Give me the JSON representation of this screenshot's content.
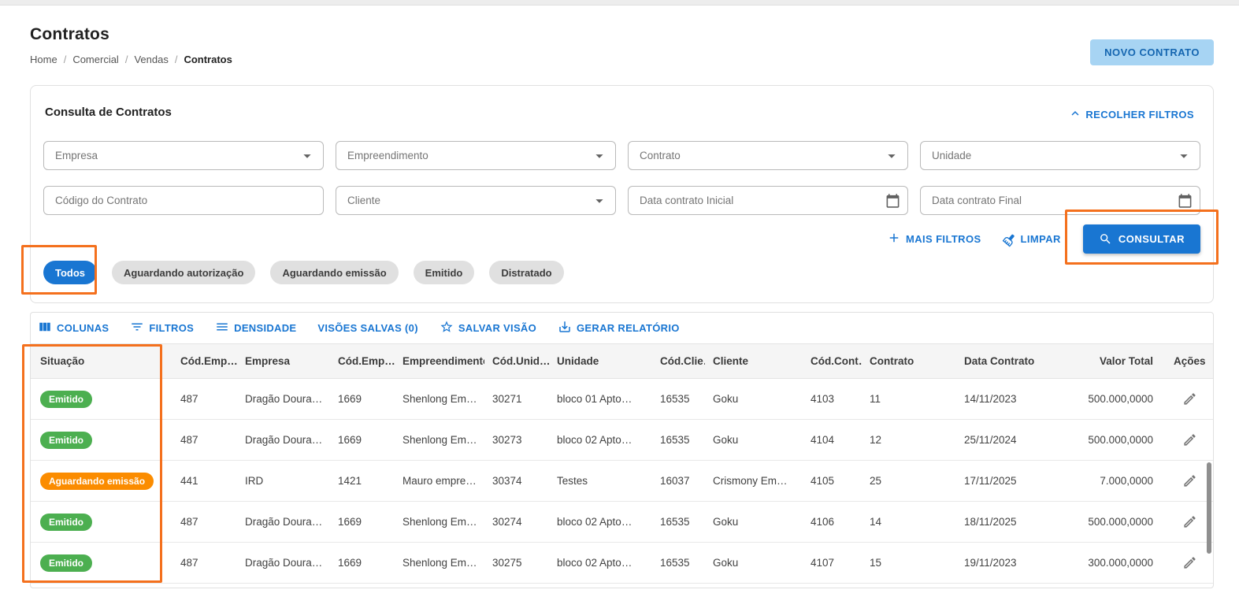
{
  "page": {
    "title": "Contratos",
    "breadcrumb": [
      "Home",
      "Comercial",
      "Vendas",
      "Contratos"
    ],
    "new_contract_label": "NOVO CONTRATO"
  },
  "filter_card": {
    "title": "Consulta de Contratos",
    "collapse_label": "RECOLHER FILTROS",
    "fields_row1": [
      {
        "placeholder": "Empresa",
        "type": "select"
      },
      {
        "placeholder": "Empreendimento",
        "type": "select"
      },
      {
        "placeholder": "Contrato",
        "type": "select"
      },
      {
        "placeholder": "Unidade",
        "type": "select"
      }
    ],
    "fields_row2": [
      {
        "placeholder": "Código do Contrato",
        "type": "text"
      },
      {
        "placeholder": "Cliente",
        "type": "select"
      },
      {
        "placeholder": "Data contrato Inicial",
        "type": "date"
      },
      {
        "placeholder": "Data contrato Final",
        "type": "date"
      }
    ],
    "more_filters_label": "MAIS FILTROS",
    "clear_label": "LIMPAR",
    "search_label": "CONSULTAR",
    "chips": [
      {
        "label": "Todos",
        "active": true
      },
      {
        "label": "Aguardando autorização",
        "active": false
      },
      {
        "label": "Aguardando emissão",
        "active": false
      },
      {
        "label": "Emitido",
        "active": false
      },
      {
        "label": "Distratado",
        "active": false
      }
    ]
  },
  "table_toolbar": {
    "items": [
      "COLUNAS",
      "FILTROS",
      "DENSIDADE",
      "VISÕES SALVAS (0)",
      "SALVAR VISÃO",
      "GERAR RELATÓRIO"
    ]
  },
  "table": {
    "headers": [
      "Situação",
      "Cód.Emp…",
      "Empresa",
      "Cód.Emp…",
      "Empreendimento",
      "Cód.Unid…",
      "Unidade",
      "Cód.Clie…",
      "Cliente",
      "Cód.Cont…",
      "Contrato",
      "Data Contrato",
      "Valor Total",
      "Ações"
    ],
    "rows": [
      {
        "situacao": "Emitido",
        "status_color": "green",
        "cod_emp": "487",
        "empresa": "Dragão Doura…",
        "cod_empreend": "1669",
        "empreendimento": "Shenlong Em…",
        "cod_unid": "30271",
        "unidade": "bloco 01 Apto…",
        "cod_cliente": "16535",
        "cliente": "Goku",
        "cod_contrato": "4103",
        "contrato": "11",
        "data_contrato": "14/11/2023",
        "valor_total": "500.000,0000"
      },
      {
        "situacao": "Emitido",
        "status_color": "green",
        "cod_emp": "487",
        "empresa": "Dragão Doura…",
        "cod_empreend": "1669",
        "empreendimento": "Shenlong Em…",
        "cod_unid": "30273",
        "unidade": "bloco 02 Apto…",
        "cod_cliente": "16535",
        "cliente": "Goku",
        "cod_contrato": "4104",
        "contrato": "12",
        "data_contrato": "25/11/2024",
        "valor_total": "500.000,0000"
      },
      {
        "situacao": "Aguardando emissão",
        "status_color": "orange",
        "cod_emp": "441",
        "empresa": "IRD",
        "cod_empreend": "1421",
        "empreendimento": "Mauro empre…",
        "cod_unid": "30374",
        "unidade": "Testes",
        "cod_cliente": "16037",
        "cliente": "Crismony Em…",
        "cod_contrato": "4105",
        "contrato": "25",
        "data_contrato": "17/11/2025",
        "valor_total": "7.000,0000"
      },
      {
        "situacao": "Emitido",
        "status_color": "green",
        "cod_emp": "487",
        "empresa": "Dragão Doura…",
        "cod_empreend": "1669",
        "empreendimento": "Shenlong Em…",
        "cod_unid": "30274",
        "unidade": "bloco 02 Apto…",
        "cod_cliente": "16535",
        "cliente": "Goku",
        "cod_contrato": "4106",
        "contrato": "14",
        "data_contrato": "18/11/2025",
        "valor_total": "500.000,0000"
      },
      {
        "situacao": "Emitido",
        "status_color": "green",
        "cod_emp": "487",
        "empresa": "Dragão Doura…",
        "cod_empreend": "1669",
        "empreendimento": "Shenlong Em…",
        "cod_unid": "30275",
        "unidade": "bloco 02 Apto…",
        "cod_cliente": "16535",
        "cliente": "Goku",
        "cod_contrato": "4107",
        "contrato": "15",
        "data_contrato": "19/11/2023",
        "valor_total": "300.000,0000"
      }
    ]
  },
  "icons": {
    "collapse": "chevron-up",
    "select_caret": "chevron-down",
    "date": "calendar",
    "more_filters": "plus",
    "clear": "broom",
    "search": "magnifier",
    "columns": "view-columns",
    "filters": "filter-list",
    "density": "rows",
    "save_view": "star",
    "report": "download",
    "edit": "pencil"
  },
  "colors": {
    "primary_blue": "#1976d2",
    "new_button_bg": "#a7d4f3",
    "badge_green": "#4caf50",
    "badge_orange": "#fb8c00",
    "chip_gray": "#e0e0e0",
    "annotation_orange": "#f4701d"
  }
}
